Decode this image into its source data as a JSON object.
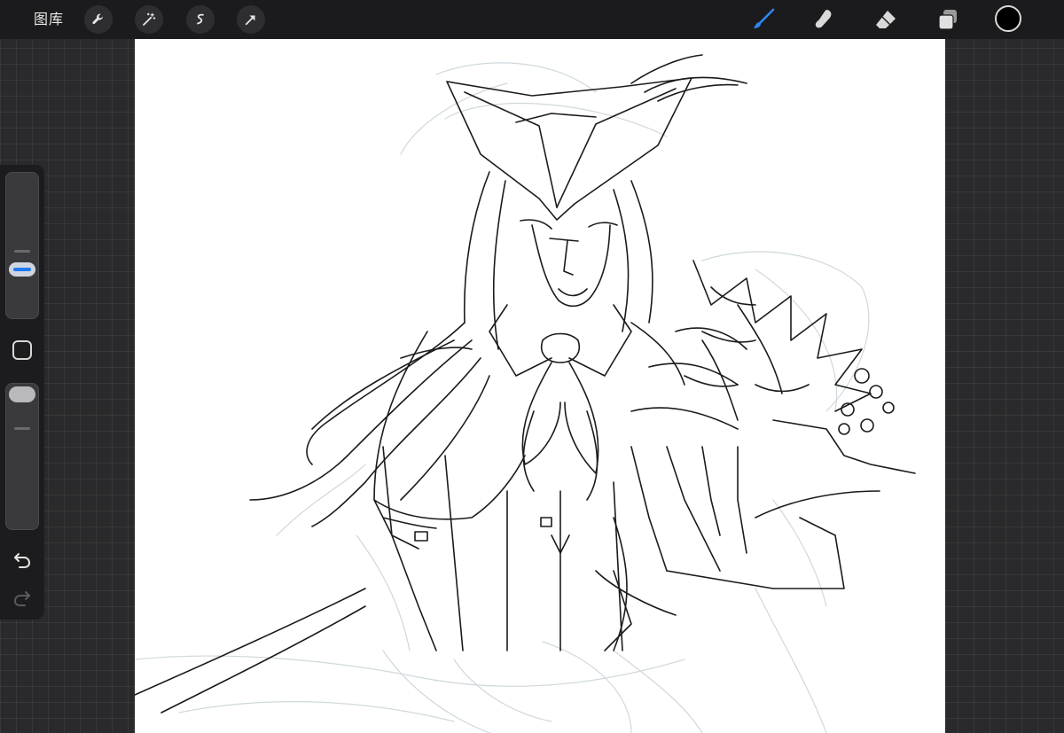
{
  "topbar": {
    "gallery_label": "图库",
    "left_tools": [
      {
        "name": "actions-wrench-icon"
      },
      {
        "name": "adjustments-magic-wand-icon"
      },
      {
        "name": "selection-icon"
      },
      {
        "name": "transform-arrow-icon"
      }
    ],
    "right_tools": [
      {
        "name": "brush-icon",
        "active": true
      },
      {
        "name": "smudge-icon"
      },
      {
        "name": "eraser-icon"
      },
      {
        "name": "layers-icon"
      }
    ],
    "current_color": "#000000"
  },
  "sidebar": {
    "brush_size_level": 0.65,
    "opacity_level": 0.95,
    "accent_color": "#1e7bf5"
  },
  "canvas": {
    "background": "#ffffff",
    "content": "line-art-sketch"
  }
}
